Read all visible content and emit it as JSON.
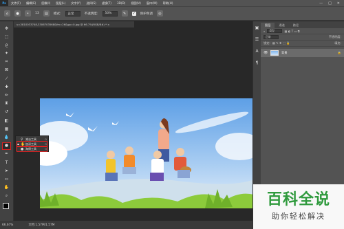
{
  "menubar": {
    "logo": "Ps",
    "items": [
      "文件(F)",
      "编辑(E)",
      "图像(I)",
      "图层(L)",
      "文字(Y)",
      "选择(S)",
      "滤镜(T)",
      "3D(D)",
      "视图(V)",
      "窗口(W)",
      "帮助(H)"
    ],
    "controls": [
      "—",
      "□",
      "✕"
    ]
  },
  "options": {
    "brush_size": "13",
    "mode_label": "模式:",
    "mode_value": "正常",
    "opacity_label": "不透明度:",
    "opacity_value": "50%",
    "protect_label": "保护色调"
  },
  "document": {
    "tab_title": "u=2810033748,3306703568&fm=26&gp=0.jpg @ 66.7%(RGB/8#) *  ×"
  },
  "flyout": {
    "items": [
      {
        "icon": "sponge-icon",
        "label": "减淡工具",
        "key": "O"
      },
      {
        "icon": "burn-icon",
        "label": "加深工具",
        "key": "O"
      },
      {
        "icon": "sponge-icon",
        "label": "海绵工具",
        "key": "O"
      }
    ]
  },
  "status": {
    "zoom": "66.67%",
    "doc_info": "文档:1.57M/1.57M"
  },
  "layers_panel": {
    "tabs": [
      "图层",
      "通道",
      "路径"
    ],
    "kind_label": "类型",
    "blend_mode": "正常",
    "opacity_label": "不透明度:",
    "lock_label": "锁定:",
    "fill_label": "填充:",
    "layer_name": "背景"
  },
  "watermark": {
    "main": "百科全说",
    "sub": "助你轻松解决"
  },
  "colors": {
    "accent_red": "#e02020",
    "panel_gray": "#535353",
    "canvas_dark": "#282828"
  }
}
